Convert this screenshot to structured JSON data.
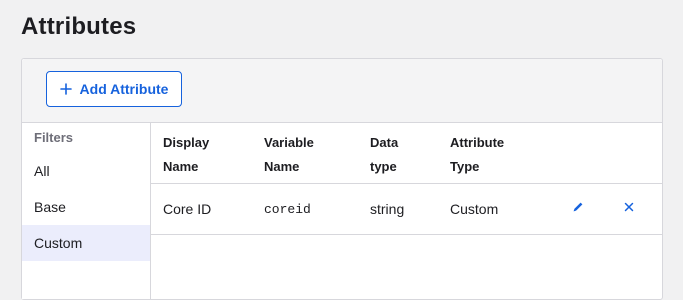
{
  "page": {
    "title": "Attributes"
  },
  "toolbar": {
    "add_button_label": "Add Attribute",
    "add_icon": "plus-icon",
    "accent": "#1662dd"
  },
  "filters": {
    "heading": "Filters",
    "items": [
      {
        "label": "All",
        "active": false
      },
      {
        "label": "Base",
        "active": false
      },
      {
        "label": "Custom",
        "active": true
      }
    ]
  },
  "table": {
    "columns": [
      {
        "line1": "Display",
        "line2": "Name"
      },
      {
        "line1": "Variable",
        "line2": "Name"
      },
      {
        "line1": "Data",
        "line2": "type"
      },
      {
        "line1": "Attribute",
        "line2": "Type"
      }
    ],
    "rows": [
      {
        "display_name": "Core ID",
        "variable_name": "coreid",
        "data_type": "string",
        "attribute_type": "Custom",
        "actions": [
          "pencil-icon",
          "close-icon"
        ]
      }
    ]
  }
}
